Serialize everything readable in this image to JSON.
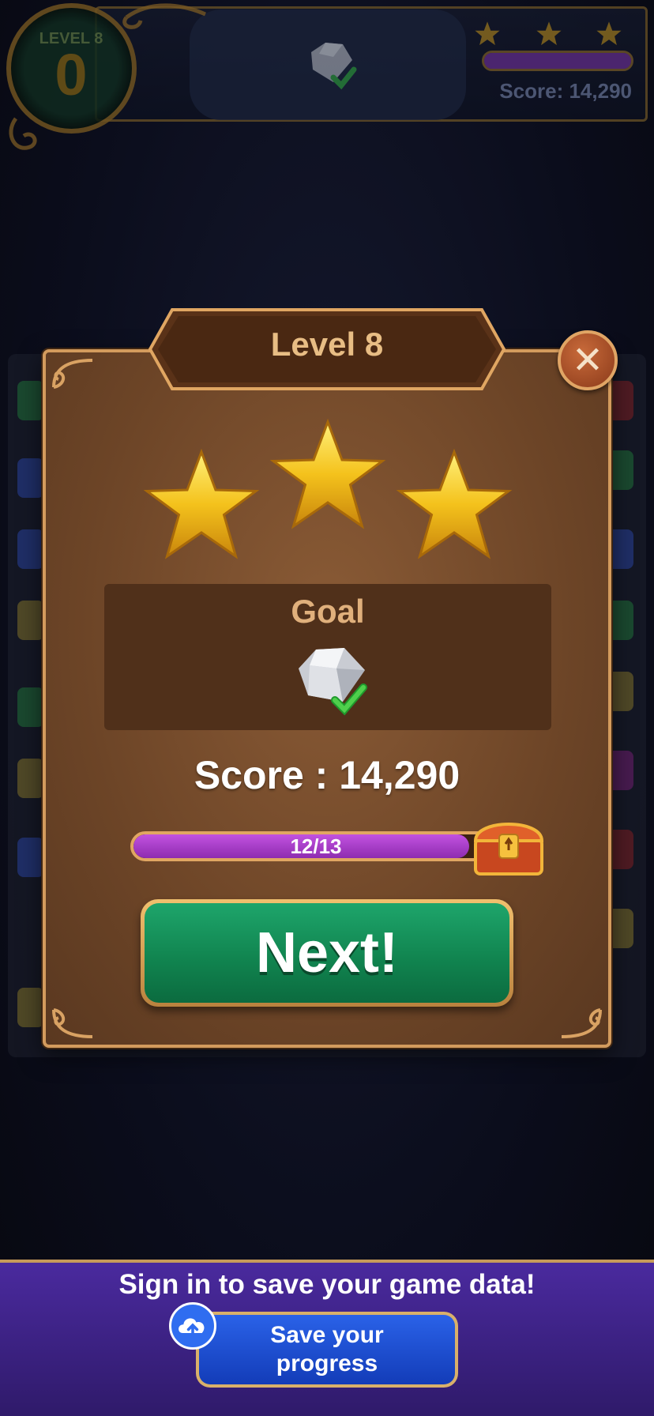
{
  "hud": {
    "level_label": "LEVEL 8",
    "moves": "0",
    "score": "Score: 14,290",
    "progress_fraction": 1.0,
    "stars": 3
  },
  "dialog": {
    "title": "Level 8",
    "close_icon": "close-icon",
    "stars_earned": 3,
    "goal_label": "Goal",
    "goal_item_icon": "diamond-icon",
    "goal_complete": true,
    "score": "Score : 14,290",
    "progress_text": "12/13",
    "progress_fraction": 0.92,
    "reward_icon": "treasure-chest-icon",
    "next_label": "Next!"
  },
  "banner": {
    "text": "Sign in to save your game data!",
    "save_label": "Save your progress",
    "cloud_icon": "cloud-upload-icon"
  },
  "colors": {
    "accent_gold": "#d39b5d",
    "next_green": "#118550",
    "progress_purple": "#a63fcb",
    "banner_purple": "#3b2184"
  }
}
